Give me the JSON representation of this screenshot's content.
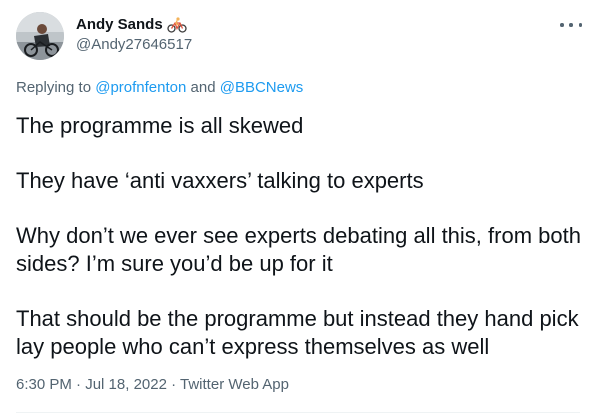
{
  "author": {
    "display_name": "Andy Sands",
    "emoji": "bicycle-rider-emoji",
    "handle": "@Andy27646517"
  },
  "replying": {
    "prefix": "Replying to ",
    "user1": "@profnfenton",
    "conjunction": " and ",
    "user2": "@BBCNews"
  },
  "body": {
    "paragraphs": [
      "The programme is all skewed",
      "They have ‘anti vaxxers’ talking to experts",
      "Why don’t we ever see experts debating all this, from both sides? I’m sure you’d be up for it",
      "That should be the programme but instead they hand pick lay people who can’t express themselves as well"
    ]
  },
  "meta": {
    "time": "6:30 PM",
    "separator1": " · ",
    "date": "Jul 18, 2022",
    "separator2": " · ",
    "source": "Twitter Web App"
  },
  "colors": {
    "text": "#0f1419",
    "secondary": "#536471",
    "link": "#1d9bf0",
    "divider": "#eff3f4"
  },
  "icons": {
    "more": "more-horizontal-icon"
  }
}
